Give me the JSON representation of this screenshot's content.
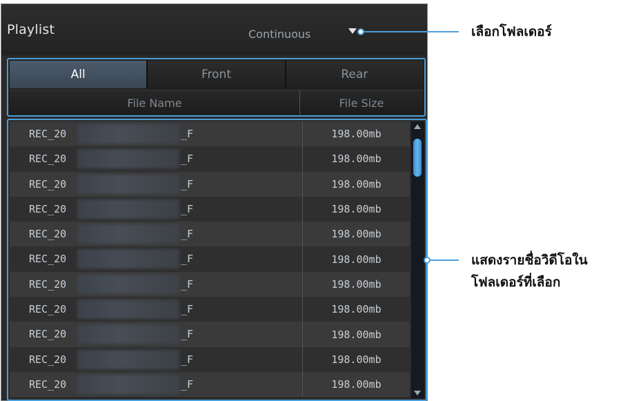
{
  "header": {
    "title": "Playlist",
    "mode": "Continuous"
  },
  "tabs": [
    {
      "label": "All"
    },
    {
      "label": "Front"
    },
    {
      "label": "Rear"
    }
  ],
  "columns": {
    "file_name": "File Name",
    "file_size": "File Size"
  },
  "rows": [
    {
      "prefix": "REC_20",
      "suffix": "_F",
      "size": "198.00mb"
    },
    {
      "prefix": "REC_20",
      "suffix": "_F",
      "size": "198.00mb"
    },
    {
      "prefix": "REC_20",
      "suffix": "_F",
      "size": "198.00mb"
    },
    {
      "prefix": "REC_20",
      "suffix": "_F",
      "size": "198.00mb"
    },
    {
      "prefix": "REC_20",
      "suffix": "_F",
      "size": "198.00mb"
    },
    {
      "prefix": "REC_20",
      "suffix": "_F",
      "size": "198.00mb"
    },
    {
      "prefix": "REC_20",
      "suffix": "_F",
      "size": "198.00mb"
    },
    {
      "prefix": "REC_20",
      "suffix": "_F",
      "size": "198.00mb"
    },
    {
      "prefix": "REC_20",
      "suffix": "_F",
      "size": "198.00mb"
    },
    {
      "prefix": "REC_20",
      "suffix": "_F",
      "size": "198.00mb"
    },
    {
      "prefix": "REC_20",
      "suffix": "_F",
      "size": "198.00mb"
    }
  ],
  "callouts": {
    "folder": "เลือกโฟลเดอร์",
    "list_line1": "แสดงรายชื่อวิดีโอใน",
    "list_line2": "โฟลเดอร์ที่เลือก"
  },
  "colors": {
    "accent": "#4a9fdb",
    "panel": "#2a2a2a",
    "active_tab": "#44525f"
  },
  "icons": [
    "dropdown-arrow-icon",
    "scroll-up-icon",
    "scroll-down-icon"
  ]
}
